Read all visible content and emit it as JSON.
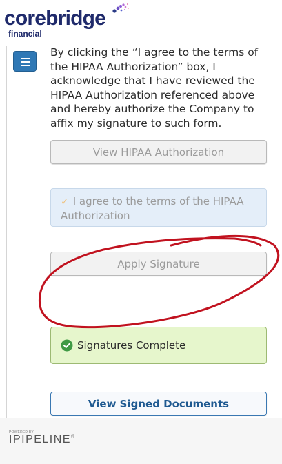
{
  "brand": {
    "name": "corebridge",
    "tagline": "financial"
  },
  "consent": {
    "text": "By clicking the “I agree to the terms of the HIPAA Authorization” box, I acknowledge that I have reviewed the HIPAA Authorization referenced above and hereby authorize the Company to affix my signature to such form."
  },
  "buttons": {
    "view_hipaa": "View HIPAA Authorization",
    "agree_label": "I agree to the terms of the HIPAA Authorization",
    "agree_checked": true,
    "apply_signature": "Apply Signature",
    "view_signed": "View Signed Documents"
  },
  "status": {
    "signatures_complete": "Signatures Complete"
  },
  "footer": {
    "powered_by": "POWERED BY",
    "vendor": "IPIPELINE",
    "vendor_mark": "®"
  },
  "icons": {
    "menu": "hamburger-menu-icon",
    "agree_check": "checkmark-icon",
    "complete": "check-circle-icon"
  },
  "colors": {
    "brand_navy": "#1f2a6b",
    "menu_blue": "#2f78b5",
    "success_bg": "#e6f6cc",
    "success_icon": "#3f9a44",
    "info_bg": "#e4eef9",
    "annotation_red": "#c1121f"
  }
}
